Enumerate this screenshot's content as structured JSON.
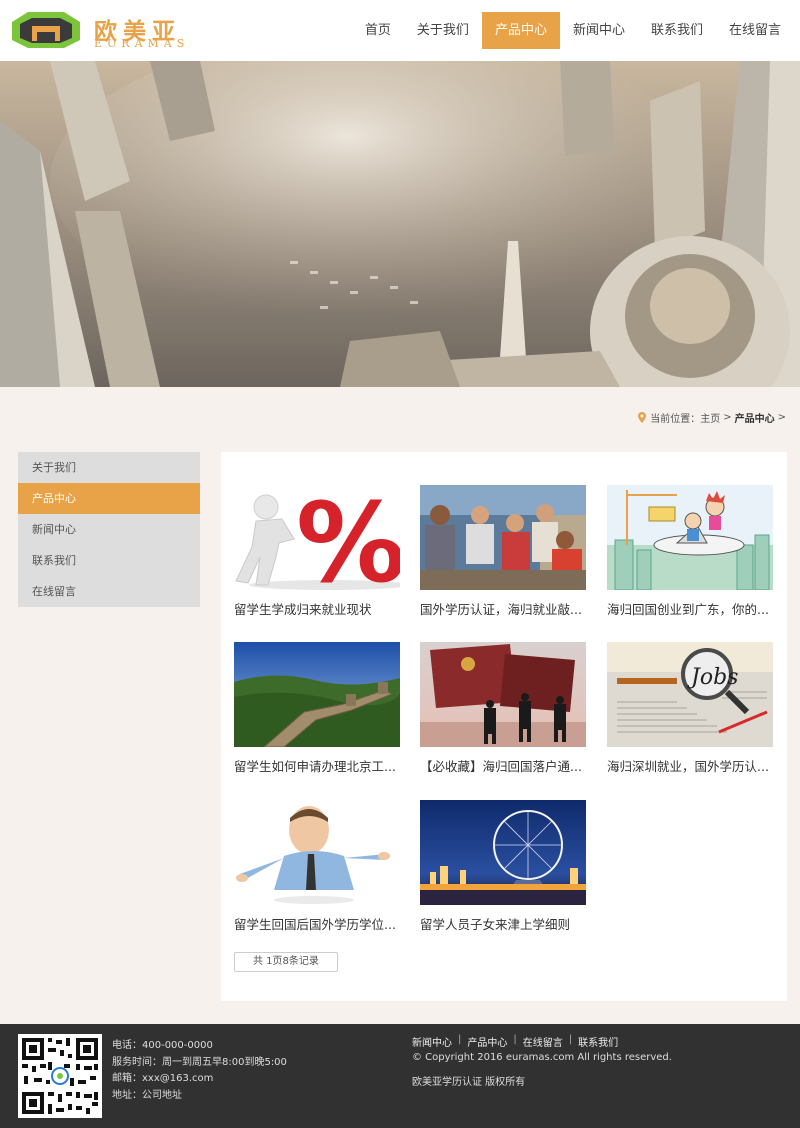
{
  "header": {
    "logo_cn": "欧美亚",
    "logo_en": "EURAMAS",
    "nav": [
      {
        "label": "首页",
        "active": false
      },
      {
        "label": "关于我们",
        "active": false
      },
      {
        "label": "产品中心",
        "active": true
      },
      {
        "label": "新闻中心",
        "active": false
      },
      {
        "label": "联系我们",
        "active": false
      },
      {
        "label": "在线留言",
        "active": false
      }
    ]
  },
  "breadcrumb": {
    "prefix": "当前位置：",
    "home": "主页",
    "sep": ">",
    "current": "产品中心",
    "trail": ">"
  },
  "sidebar": {
    "items": [
      {
        "label": "关于我们",
        "active": false
      },
      {
        "label": "产品中心",
        "active": true
      },
      {
        "label": "新闻中心",
        "active": false
      },
      {
        "label": "联系我们",
        "active": false
      },
      {
        "label": "在线留言",
        "active": false
      }
    ]
  },
  "products": [
    {
      "title": "留学生学成归来就业现状",
      "image": "percent-figure"
    },
    {
      "title": "国外学历认证，海归就业敲...",
      "image": "students-group"
    },
    {
      "title": "海归回国创业到广东，你的...",
      "image": "cartoon-plane"
    },
    {
      "title": "留学生如何申请办理北京工...",
      "image": "great-wall"
    },
    {
      "title": "【必收藏】海归回国落户通...",
      "image": "passport-silhouettes"
    },
    {
      "title": "海归深圳就业，国外学历认...",
      "image": "jobs-magnifier"
    },
    {
      "title": "留学生回国后国外学历学位...",
      "image": "man-shrugging"
    },
    {
      "title": "留学人员子女来津上学细则",
      "image": "ferris-wheel"
    }
  ],
  "pager": {
    "text": "共 1页8条记录"
  },
  "footer": {
    "contact": [
      "电话：400-000-0000",
      "服务时间：周一到周五早8:00到晚5:00",
      "邮箱：xxx@163.com",
      "地址：公司地址"
    ],
    "links": [
      "新闻中心",
      "产品中心",
      "在线留言",
      "联系我们"
    ],
    "copyright": "© Copyright 2016 euramas.com All rights reserved.",
    "rights": "欧美亚学历认证 版权所有"
  },
  "colors": {
    "accent": "#e8a348",
    "background": "#f6f1ec",
    "footer": "#313131"
  }
}
